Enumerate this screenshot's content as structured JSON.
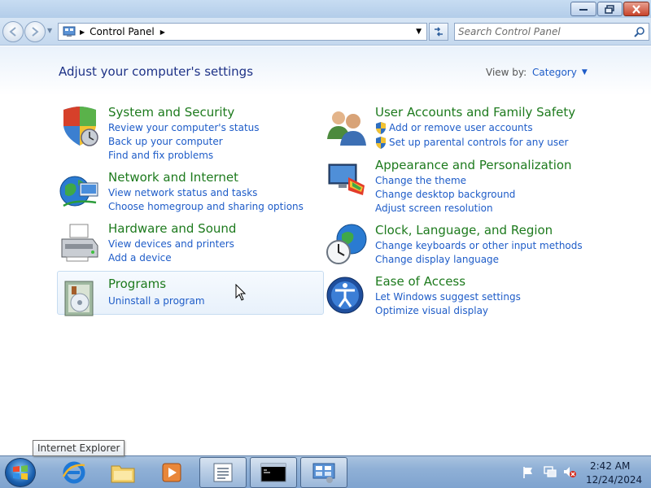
{
  "address": {
    "crumb": "Control Panel",
    "search_placeholder": "Search Control Panel"
  },
  "page": {
    "heading": "Adjust your computer's settings",
    "view_by_label": "View by:",
    "view_by_value": "Category"
  },
  "categories": {
    "system_security": {
      "title": "System and Security",
      "links": [
        "Review your computer's status",
        "Back up your computer",
        "Find and fix problems"
      ]
    },
    "network": {
      "title": "Network and Internet",
      "links": [
        "View network status and tasks",
        "Choose homegroup and sharing options"
      ]
    },
    "hardware": {
      "title": "Hardware and Sound",
      "links": [
        "View devices and printers",
        "Add a device"
      ]
    },
    "programs": {
      "title": "Programs",
      "links": [
        "Uninstall a program"
      ]
    },
    "user_accounts": {
      "title": "User Accounts and Family Safety",
      "links": [
        "Add or remove user accounts",
        "Set up parental controls for any user"
      ]
    },
    "appearance": {
      "title": "Appearance and Personalization",
      "links": [
        "Change the theme",
        "Change desktop background",
        "Adjust screen resolution"
      ]
    },
    "clock": {
      "title": "Clock, Language, and Region",
      "links": [
        "Change keyboards or other input methods",
        "Change display language"
      ]
    },
    "ease": {
      "title": "Ease of Access",
      "links": [
        "Let Windows suggest settings",
        "Optimize visual display"
      ]
    }
  },
  "taskbar": {
    "tooltip": "Internet Explorer",
    "time": "2:42 AM",
    "date": "12/24/2024",
    "apps": [
      "internet-explorer-icon",
      "explorer-folder-icon",
      "media-player-icon",
      "notepad-icon",
      "command-prompt-icon",
      "control-panel-icon"
    ]
  },
  "colors": {
    "category_title": "#1d7a1d",
    "link": "#1e5cc8",
    "heading": "#1e3287"
  }
}
